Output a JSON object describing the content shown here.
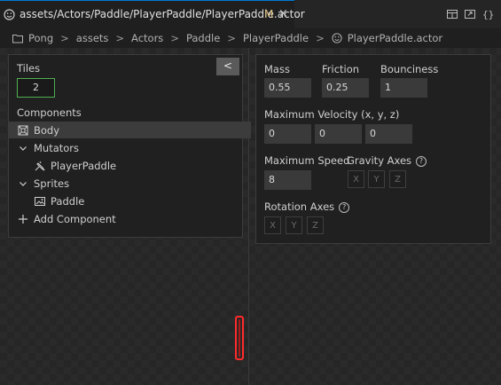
{
  "tab": {
    "title": "assets/Actors/Paddle/PlayerPaddle/PlayerPaddle.actor",
    "modified_marker": "M",
    "close_glyph": "×",
    "icon": "smiley-icon",
    "actions": [
      "split-layout-icon",
      "open-preview-icon",
      "json-braces-icon"
    ]
  },
  "breadcrumb": {
    "items": [
      "Pong",
      "assets",
      "Actors",
      "Paddle",
      "PlayerPaddle",
      "PlayerPaddle.actor"
    ],
    "separator": ">"
  },
  "left_panel": {
    "tiles_label": "Tiles",
    "tiles_value": "2",
    "collapse_glyph": "<",
    "components_label": "Components",
    "tree": [
      {
        "label": "Body",
        "icon": "body-icon",
        "selected": true
      },
      {
        "label": "Mutators",
        "icon": "chevron-down-icon"
      },
      {
        "label": "PlayerPaddle",
        "icon": "mutator-icon"
      },
      {
        "label": "Sprites",
        "icon": "chevron-down-icon"
      },
      {
        "label": "Paddle",
        "icon": "image-icon"
      },
      {
        "label": "Add Component",
        "icon": "plus-icon"
      }
    ]
  },
  "right_panel": {
    "mass_label": "Mass",
    "mass_value": "0.55",
    "friction_label": "Friction",
    "friction_value": "0.25",
    "bounciness_label": "Bounciness",
    "bounciness_value": "1",
    "max_velocity_label": "Maximum Velocity (x, y, z)",
    "max_velocity": [
      "0",
      "0",
      "0"
    ],
    "max_speed_label": "Maximum Speed",
    "max_speed_value": "8",
    "gravity_axes_label": "Gravity Axes",
    "rotation_axes_label": "Rotation Axes",
    "axes": [
      "X",
      "Y",
      "Z"
    ],
    "help_glyph": "?"
  },
  "colors": {
    "accent": "#0078d4",
    "modified": "#d7ba7d",
    "paddle_outline": "#ff2a2a",
    "tiles_border": "#4fb04f"
  }
}
